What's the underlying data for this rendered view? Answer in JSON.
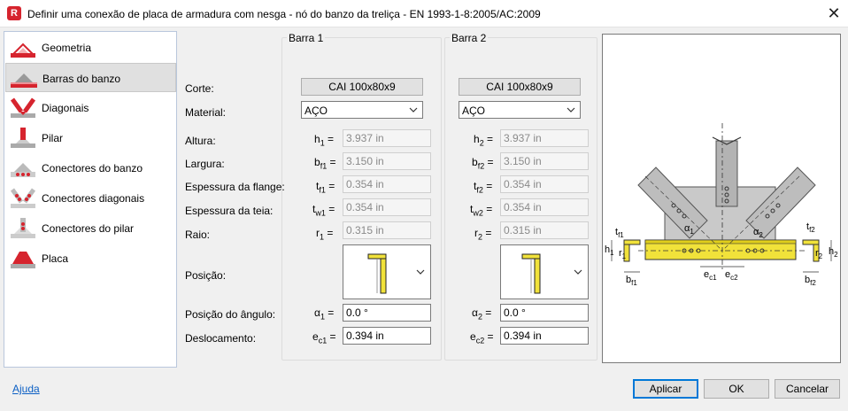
{
  "window": {
    "title": "Definir uma conexão de placa de armadura com nesga - nó do banzo da treliça - EN 1993-1-8:2005/AC:2009",
    "app_icon_letter": "R",
    "close_glyph": "✕"
  },
  "sidebar": {
    "items": [
      {
        "label": "Geometria",
        "icon": "geometry-icon",
        "selected": false
      },
      {
        "label": "Barras do banzo",
        "icon": "chord-bars-icon",
        "selected": true
      },
      {
        "label": "Diagonais",
        "icon": "diagonals-icon",
        "selected": false
      },
      {
        "label": "Pilar",
        "icon": "column-icon",
        "selected": false
      },
      {
        "label": "Conectores do banzo",
        "icon": "chord-connectors-icon",
        "selected": false
      },
      {
        "label": "Conectores diagonais",
        "icon": "diagonal-connectors-icon",
        "selected": false
      },
      {
        "label": "Conectores do pilar",
        "icon": "column-connectors-icon",
        "selected": false
      },
      {
        "label": "Placa",
        "icon": "plate-icon",
        "selected": false
      }
    ]
  },
  "labels": {
    "corte": "Corte:",
    "material": "Material:",
    "altura": "Altura:",
    "largura": "Largura:",
    "espessura_flange": "Espessura da flange:",
    "espessura_teia": "Espessura da teia:",
    "raio": "Raio:",
    "posicao": "Posição:",
    "posicao_angulo": "Posição do ângulo:",
    "deslocamento": "Deslocamento:"
  },
  "bar1": {
    "title": "Barra 1",
    "section": "CAI 100x80x9",
    "material": "AÇO",
    "h_sym": "h",
    "h_sub": "1",
    "h": "3.937 in",
    "b_sym": "b",
    "b_sub": "f1",
    "b": "3.150 in",
    "tf_sym": "t",
    "tf_sub": "f1",
    "tf": "0.354 in",
    "tw_sym": "t",
    "tw_sub": "w1",
    "tw": "0.354 in",
    "r_sym": "r",
    "r_sub": "1",
    "r": "0.315 in",
    "alpha_sym": "α",
    "alpha_sub": "1",
    "alpha": "0.0 °",
    "e_sym": "e",
    "e_sub": "c1",
    "e": "0.394 in",
    "eq": "="
  },
  "bar2": {
    "title": "Barra 2",
    "section": "CAI 100x80x9",
    "material": "AÇO",
    "h_sym": "h",
    "h_sub": "2",
    "h": "3.937 in",
    "b_sym": "b",
    "b_sub": "f2",
    "b": "3.150 in",
    "tf_sym": "t",
    "tf_sub": "f2",
    "tf": "0.354 in",
    "tw_sym": "t",
    "tw_sub": "w2",
    "tw": "0.354 in",
    "r_sym": "r",
    "r_sub": "2",
    "r": "0.315 in",
    "alpha_sym": "α",
    "alpha_sub": "2",
    "alpha": "0.0 °",
    "e_sym": "e",
    "e_sub": "c2",
    "e": "0.394 in",
    "eq": "="
  },
  "drawing_labels": {
    "tf1": "t",
    "tf1_sub": "f1",
    "h1": "h",
    "h1_sub": "1",
    "r1": "r",
    "r1_sub": "1",
    "bf1": "b",
    "bf1_sub": "f1",
    "alpha1": "α",
    "alpha1_sub": "1",
    "alpha2": "α",
    "alpha2_sub": "2",
    "ec1": "e",
    "ec1_sub": "c1",
    "ec2": "e",
    "ec2_sub": "c2",
    "tf2": "t",
    "tf2_sub": "f2",
    "h2": "h",
    "h2_sub": "2",
    "r2": "r",
    "r2_sub": "2",
    "bf2": "b",
    "bf2_sub": "f2"
  },
  "footer": {
    "help": "Ajuda",
    "apply": "Aplicar",
    "ok": "OK",
    "cancel": "Cancelar"
  },
  "colors": {
    "accent_red": "#d6242e",
    "chord_yellow": "#f1e23a",
    "link_blue": "#0b5fc4",
    "default_button_border": "#0078d7"
  }
}
